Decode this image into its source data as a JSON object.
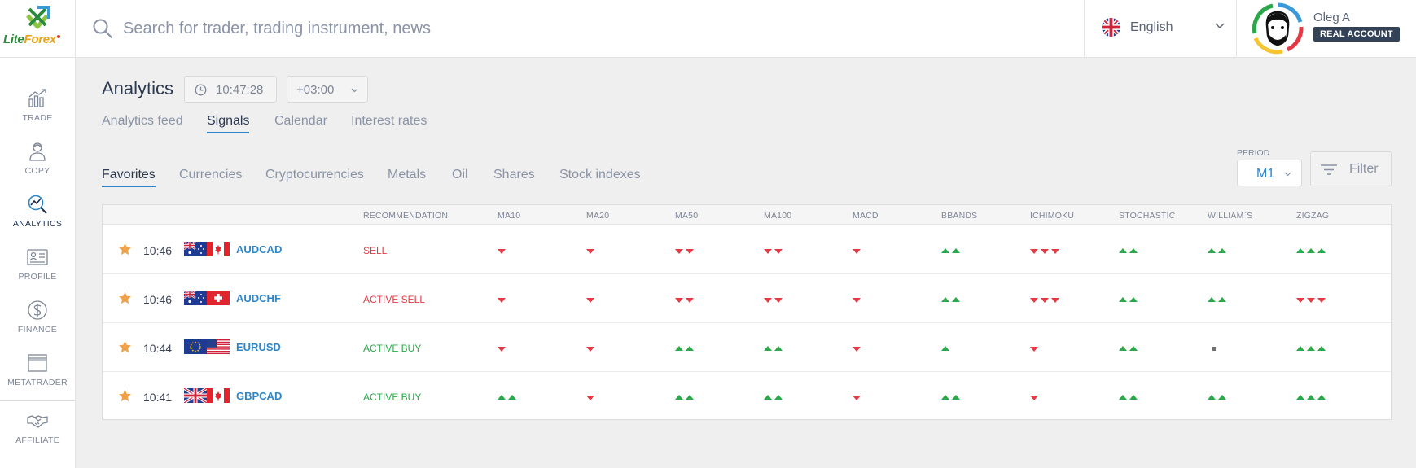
{
  "brand": {
    "logo_part1": "Lite",
    "logo_part2": "Forex"
  },
  "search": {
    "placeholder": "Search for trader, trading instrument, news"
  },
  "language": {
    "label": "English"
  },
  "user": {
    "name": "Oleg A",
    "account_type": "REAL ACCOUNT"
  },
  "sidebar": {
    "items": [
      {
        "label": "TRADE",
        "icon": "trade-chart-icon"
      },
      {
        "label": "COPY",
        "icon": "copy-person-icon"
      },
      {
        "label": "ANALYTICS",
        "icon": "analytics-icon",
        "active": true
      },
      {
        "label": "PROFILE",
        "icon": "profile-card-icon"
      },
      {
        "label": "FINANCE",
        "icon": "dollar-icon"
      },
      {
        "label": "METATRADER",
        "icon": "window-icon"
      },
      {
        "label": "AFFILIATE",
        "icon": "handshake-icon"
      }
    ]
  },
  "header": {
    "title": "Analytics",
    "time": "10:47:28",
    "timezone": "+03:00"
  },
  "tabs": [
    "Analytics feed",
    "Signals",
    "Calendar",
    "Interest rates"
  ],
  "active_tab": "Signals",
  "subtabs": [
    "Favorites",
    "Currencies",
    "Cryptocurrencies",
    "Metals",
    "Oil",
    "Shares",
    "Stock indexes"
  ],
  "active_subtab": "Favorites",
  "period": {
    "label": "PERIOD",
    "value": "M1"
  },
  "filter": {
    "label": "Filter"
  },
  "table": {
    "columns": [
      "RECOMMENDATION",
      "MA10",
      "MA20",
      "MA50",
      "MA100",
      "MACD",
      "BBANDS",
      "ICHIMOKU",
      "STOCHASTIC",
      "WILLIAM`S",
      "ZIGZAG"
    ],
    "rows": [
      {
        "time": "10:46",
        "pair": "AUDCAD",
        "flags": [
          "au",
          "ca"
        ],
        "recommendation": "SELL",
        "rec_type": "sell",
        "signals": [
          "d1",
          "d1",
          "d2",
          "d2",
          "d1",
          "u2",
          "d3",
          "u2",
          "u2",
          "u3"
        ]
      },
      {
        "time": "10:46",
        "pair": "AUDCHF",
        "flags": [
          "au",
          "ch"
        ],
        "recommendation": "ACTIVE SELL",
        "rec_type": "sell",
        "signals": [
          "d1",
          "d1",
          "d2",
          "d2",
          "d1",
          "u2",
          "d3",
          "u2",
          "u2",
          "d3"
        ]
      },
      {
        "time": "10:44",
        "pair": "EURUSD",
        "flags": [
          "eu",
          "us"
        ],
        "recommendation": "ACTIVE BUY",
        "rec_type": "buy",
        "signals": [
          "d1",
          "d1",
          "u2",
          "u2",
          "d1",
          "u1",
          "d1",
          "u2",
          "n",
          "u3"
        ]
      },
      {
        "time": "10:41",
        "pair": "GBPCAD",
        "flags": [
          "gb",
          "ca"
        ],
        "recommendation": "ACTIVE BUY",
        "rec_type": "buy",
        "signals": [
          "u2",
          "d1",
          "u2",
          "u2",
          "d1",
          "u2",
          "d1",
          "u2",
          "u2",
          "u3"
        ]
      }
    ]
  },
  "colors": {
    "accent": "#2e86c9",
    "sell": "#e53945",
    "buy": "#2ba84a",
    "neutral": "#707070",
    "star": "#f0a24a"
  }
}
